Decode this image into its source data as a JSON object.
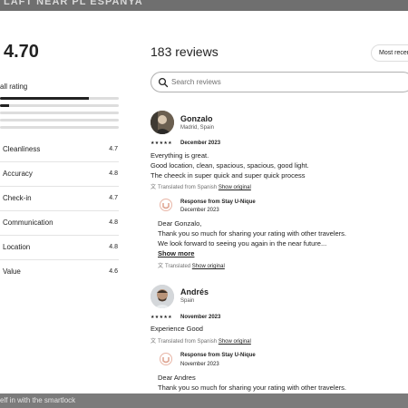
{
  "background": {
    "top_text": "LAFT NEAR PL ESPANYA",
    "bottom_text": "elf in with the smartlock"
  },
  "rating": {
    "value": "4.70",
    "overall_label": "all rating",
    "distribution": [
      0.75,
      0.08,
      0.0,
      0.0,
      0.0
    ],
    "categories": [
      {
        "name": "Cleanliness",
        "value": "4.7"
      },
      {
        "name": "Accuracy",
        "value": "4.8"
      },
      {
        "name": "Check-in",
        "value": "4.7"
      },
      {
        "name": "Communication",
        "value": "4.8"
      },
      {
        "name": "Location",
        "value": "4.8"
      },
      {
        "name": "Value",
        "value": "4.6"
      }
    ]
  },
  "reviews_header": {
    "count_label": "183 reviews",
    "sort_label": "Most recent",
    "search_placeholder": "Search reviews"
  },
  "reviews": [
    {
      "name": "Gonzalo",
      "location": "Madrid, Spain",
      "stars": "★★★★★",
      "date": "December 2023",
      "lines": [
        "Everything is great.",
        "Good location, clean, spacious, spacious, good light.",
        "The cheeck in super quick and super quick process"
      ],
      "translated": "Translated from Spanish",
      "show_original": "Show original",
      "response": {
        "title": "Response from Stay U-Nique",
        "date": "December 2023",
        "lines": [
          "Dear Gonzalo,",
          "Thank you so much for sharing your rating with other travelers.",
          "We look forward to seeing you again in the near future..."
        ],
        "show_more": "Show more",
        "translated": "Translated",
        "show_original": "Show original"
      }
    },
    {
      "name": "Andrés",
      "location": "Spain",
      "stars": "★★★★★",
      "date": "November 2023",
      "lines": [
        "Experience Good"
      ],
      "translated": "Translated from Spanish",
      "show_original": "Show original",
      "response": {
        "title": "Response from Stay U-Nique",
        "date": "November 2023",
        "lines": [
          "Dear Andres",
          "Thank you so much for sharing your rating with other travelers."
        ]
      }
    }
  ]
}
